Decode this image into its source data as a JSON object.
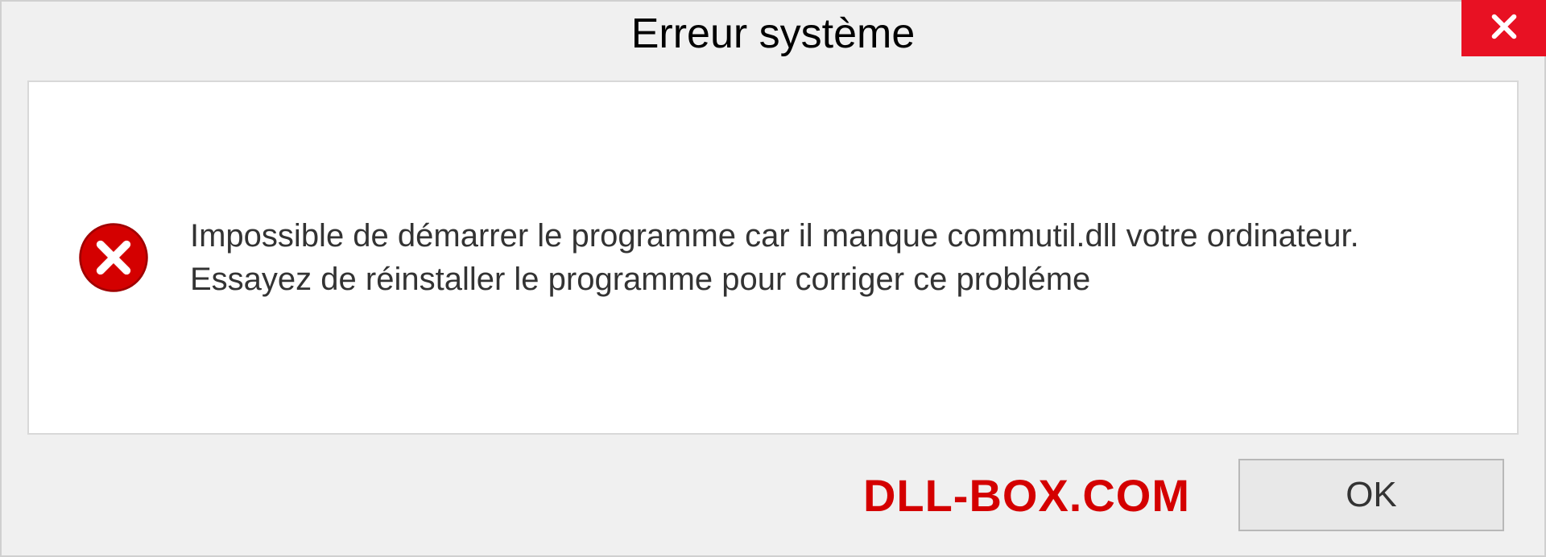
{
  "dialog": {
    "title": "Erreur système",
    "message": "Impossible de démarrer le programme car il manque commutil.dll votre ordinateur. Essayez de réinstaller le programme pour corriger ce probléme",
    "ok_label": "OK",
    "brand": "DLL-BOX.COM"
  },
  "colors": {
    "close_button": "#e81123",
    "error_icon": "#d40000",
    "brand_text": "#d40000"
  }
}
